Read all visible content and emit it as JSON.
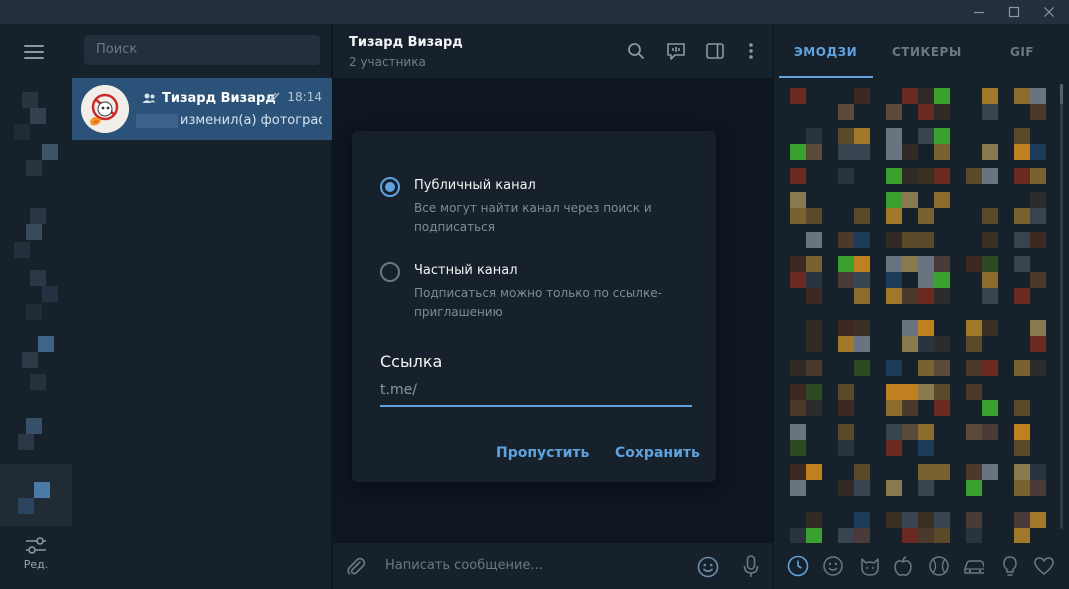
{
  "titlebar": {
    "buttons": [
      "minimize",
      "maximize",
      "close"
    ]
  },
  "folders": {
    "edit_label": "Ред."
  },
  "search": {
    "placeholder": "Поиск"
  },
  "chat_list": [
    {
      "name": "Тизард Визард",
      "time": "18:14",
      "preview": "изменил(а) фотограф…",
      "is_group": true,
      "read": true
    }
  ],
  "chat_header": {
    "title": "Тизард Визард",
    "subtitle": "2 участника"
  },
  "composer": {
    "placeholder": "Написать сообщение..."
  },
  "dialog": {
    "options": [
      {
        "title": "Публичный канал",
        "description": "Все могут найти канал через поиск и подписаться",
        "selected": true
      },
      {
        "title": "Частный канал",
        "description": "Подписаться можно только по ссылке-приглашению",
        "selected": false
      }
    ],
    "link_label": "Ссылка",
    "link_prefix": "t.me/",
    "skip_button": "Пропустить",
    "save_button": "Сохранить"
  },
  "emoji_panel": {
    "tabs": [
      "ЭМОДЗИ",
      "СТИКЕРЫ",
      "GIF"
    ],
    "active_tab": "ЭМОДЗИ",
    "categories": [
      "recent-icon",
      "smile-icon",
      "cat-icon",
      "apple-icon",
      "ball-icon",
      "car-icon",
      "bulb-icon",
      "heart-icon"
    ]
  },
  "colors": {
    "accent": "#5fa3de",
    "selected_chat": "#2b5278",
    "panel": "#17212b",
    "background": "#0e1621"
  }
}
